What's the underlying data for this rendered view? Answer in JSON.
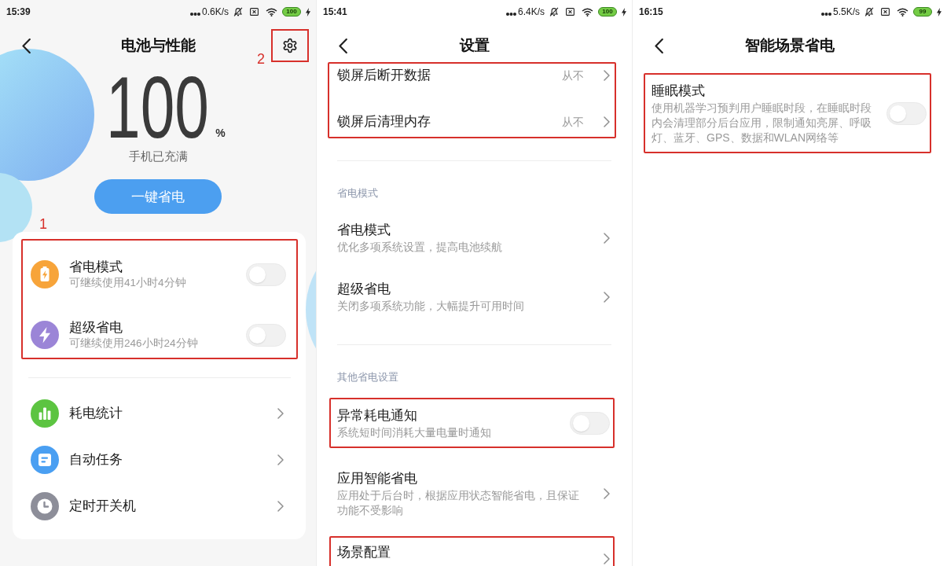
{
  "screens": [
    {
      "kind": "overview",
      "status_bar": {
        "time": "15:39",
        "net_speed": "0.6K/s",
        "battery": "100",
        "charging": true
      },
      "title": "电池与性能",
      "settings_button": {
        "highlighted": true,
        "callout": "2"
      },
      "charge_level": "100",
      "charge_unit": "%",
      "charge_status": "手机已充满",
      "action_button": "一键省电",
      "modes_callout": "1",
      "modes_highlighted": true,
      "modes": [
        {
          "title": "省电模式",
          "subtitle": "可继续使用41小时4分钟",
          "on": false,
          "color": "#f7a43a"
        },
        {
          "title": "超级省电",
          "subtitle": "可继续使用246小时24分钟",
          "on": false,
          "color": "#9b85d7"
        }
      ],
      "links": [
        {
          "title": "耗电统计",
          "color": "#5cc441"
        },
        {
          "title": "自动任务",
          "color": "#4a9ff2"
        },
        {
          "title": "定时开关机",
          "color": "#8d8e99"
        }
      ]
    },
    {
      "kind": "settings",
      "status_bar": {
        "time": "15:41",
        "net_speed": "6.4K/s",
        "battery": "100",
        "charging": true
      },
      "title": "设置",
      "sections": [
        {
          "highlighted": true,
          "rows": [
            {
              "kind": "value",
              "title": "锁屏后断开数据",
              "value": "从不",
              "highlighted": false
            },
            {
              "kind": "value",
              "title": "锁屏后清理内存",
              "value": "从不",
              "highlighted": false
            }
          ]
        },
        {
          "header": "省电模式",
          "highlighted": false,
          "rows": [
            {
              "kind": "link",
              "title": "省电模式",
              "subtitle": "优化多项系统设置，提高电池续航",
              "highlighted": false
            },
            {
              "kind": "link",
              "title": "超级省电",
              "subtitle": "关闭多项系统功能，大幅提升可用时间",
              "highlighted": false
            }
          ]
        },
        {
          "header": "其他省电设置",
          "highlighted": false,
          "rows": [
            {
              "kind": "switch",
              "title": "异常耗电通知",
              "subtitle": "系统短时间消耗大量电量时通知",
              "on": false,
              "highlighted": true
            },
            {
              "kind": "link",
              "title": "应用智能省电",
              "subtitle": "应用处于后台时，根据应用状态智能省电，且保证功能不受影响",
              "highlighted": false
            },
            {
              "kind": "link",
              "title": "场景配置",
              "highlighted": true
            }
          ]
        }
      ]
    },
    {
      "kind": "detail",
      "status_bar": {
        "time": "16:15",
        "net_speed": "5.5K/s",
        "battery": "99",
        "charging": true
      },
      "title": "智能场景省电",
      "rows": [
        {
          "kind": "switch",
          "title": "睡眠模式",
          "subtitle": "使用机器学习预判用户睡眠时段，在睡眠时段内会清理部分后台应用，限制通知亮屏、呼吸灯、蓝牙、GPS、数据和WLAN网络等",
          "on": false,
          "highlighted": true
        }
      ]
    }
  ]
}
